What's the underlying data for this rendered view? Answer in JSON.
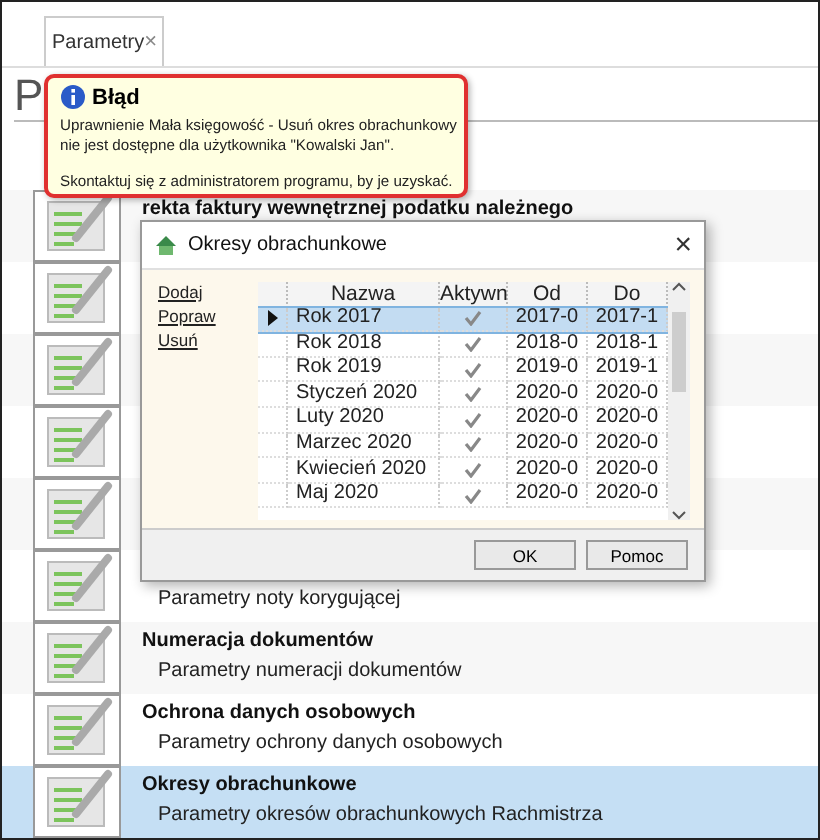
{
  "tab": {
    "label": "Parametry",
    "close": "×"
  },
  "page_heading": "P",
  "items": [
    {
      "title": "rekta faktury wewnętrznej podatku należnego",
      "selected": false
    },
    {
      "selected": false
    },
    {
      "selected": false
    },
    {
      "selected": false
    },
    {
      "selected": false
    },
    {
      "subtitle": "Parametry noty korygującej",
      "selected": false
    },
    {
      "title": "Numeracja dokumentów",
      "subtitle": "Parametry numeracji dokumentów",
      "selected": false
    },
    {
      "title": "Ochrona danych osobowych",
      "subtitle": "Parametry ochrony danych osobowych",
      "selected": false
    },
    {
      "title": "Okresy obrachunkowe",
      "subtitle": "Parametry okresów obrachunkowych Rachmistrza",
      "selected": true
    }
  ],
  "error_tooltip": {
    "title": "Błąd",
    "message": [
      "Uprawnienie Mała księgowość - Usuń okres obrachunkowy",
      "nie jest dostępne dla użytkownika \"Kowalski Jan\"."
    ],
    "hint": "Skontaktuj się z administratorem programu, by je uzyskać."
  },
  "dialog": {
    "title": "Okresy obrachunkowe",
    "close": "×",
    "actions": [
      "Dodaj",
      "Popraw",
      "Usuń"
    ],
    "columns": [
      "Nazwa",
      "Aktywn",
      "Od",
      "Do"
    ],
    "rows": [
      {
        "name": "Rok 2017",
        "active": true,
        "from": "2017-0",
        "to": "2017-1",
        "selected": true
      },
      {
        "name": "Rok 2018",
        "active": true,
        "from": "2018-0",
        "to": "2018-1",
        "selected": false
      },
      {
        "name": "Rok 2019",
        "active": true,
        "from": "2019-0",
        "to": "2019-1",
        "selected": false
      },
      {
        "name": "Styczeń 2020",
        "active": true,
        "from": "2020-0",
        "to": "2020-0",
        "selected": false
      },
      {
        "name": "Luty 2020",
        "active": true,
        "from": "2020-0",
        "to": "2020-0",
        "selected": false
      },
      {
        "name": "Marzec 2020",
        "active": true,
        "from": "2020-0",
        "to": "2020-0",
        "selected": false
      },
      {
        "name": "Kwiecień 2020",
        "active": true,
        "from": "2020-0",
        "to": "2020-0",
        "selected": false
      },
      {
        "name": "Maj 2020",
        "active": true,
        "from": "2020-0",
        "to": "2020-0",
        "selected": false
      }
    ],
    "buttons": [
      "OK",
      "Pomoc"
    ]
  }
}
